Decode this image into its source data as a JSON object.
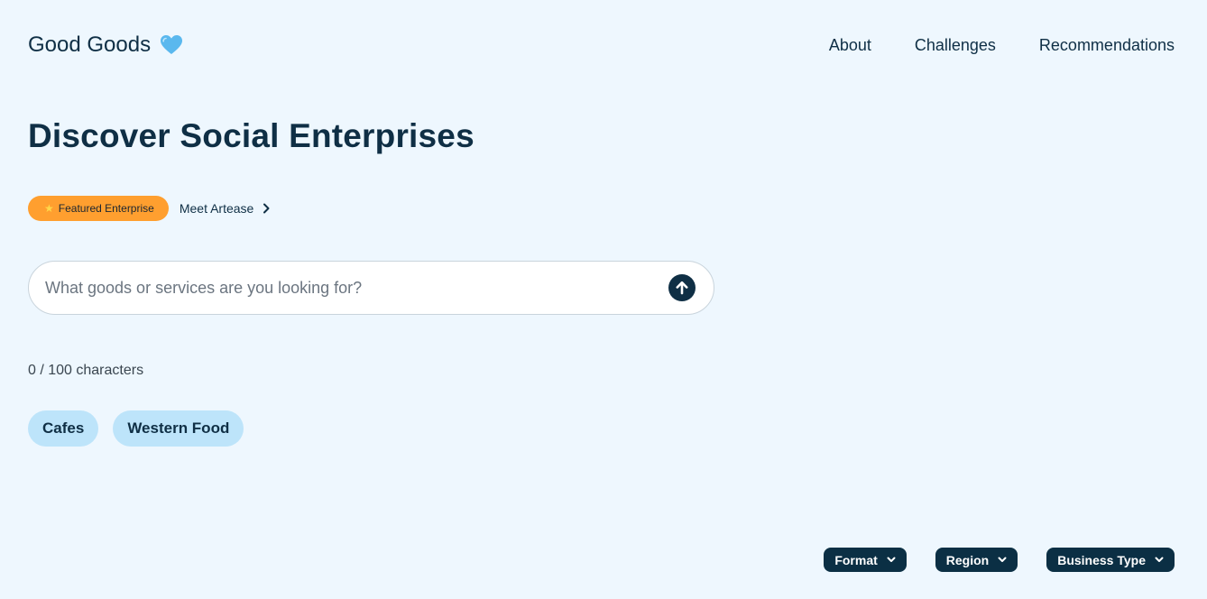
{
  "brand": {
    "name": "Good Goods",
    "icon": "blue-heart-icon"
  },
  "nav": {
    "items": [
      {
        "label": "About"
      },
      {
        "label": "Challenges"
      },
      {
        "label": "Recommendations"
      }
    ]
  },
  "hero": {
    "title": "Discover Social Enterprises"
  },
  "featured": {
    "badge_label": "Featured Enterprise",
    "badge_icon": "star-icon",
    "link_label": "Meet Artease",
    "link_icon": "chevron-right-icon"
  },
  "search": {
    "placeholder": "What goods or services are you looking for?",
    "value": "",
    "submit_icon": "arrow-up-icon"
  },
  "counter": {
    "text": "0 / 100 characters"
  },
  "chips": [
    {
      "label": "Cafes"
    },
    {
      "label": "Western Food"
    }
  ],
  "filters": [
    {
      "label": "Format"
    },
    {
      "label": "Region"
    },
    {
      "label": "Business Type"
    }
  ],
  "colors": {
    "background": "#eef7fe",
    "text": "#0f2f45",
    "badge": "#ff9f2f",
    "chip": "#bde4fa",
    "filter": "#0b2f44"
  }
}
